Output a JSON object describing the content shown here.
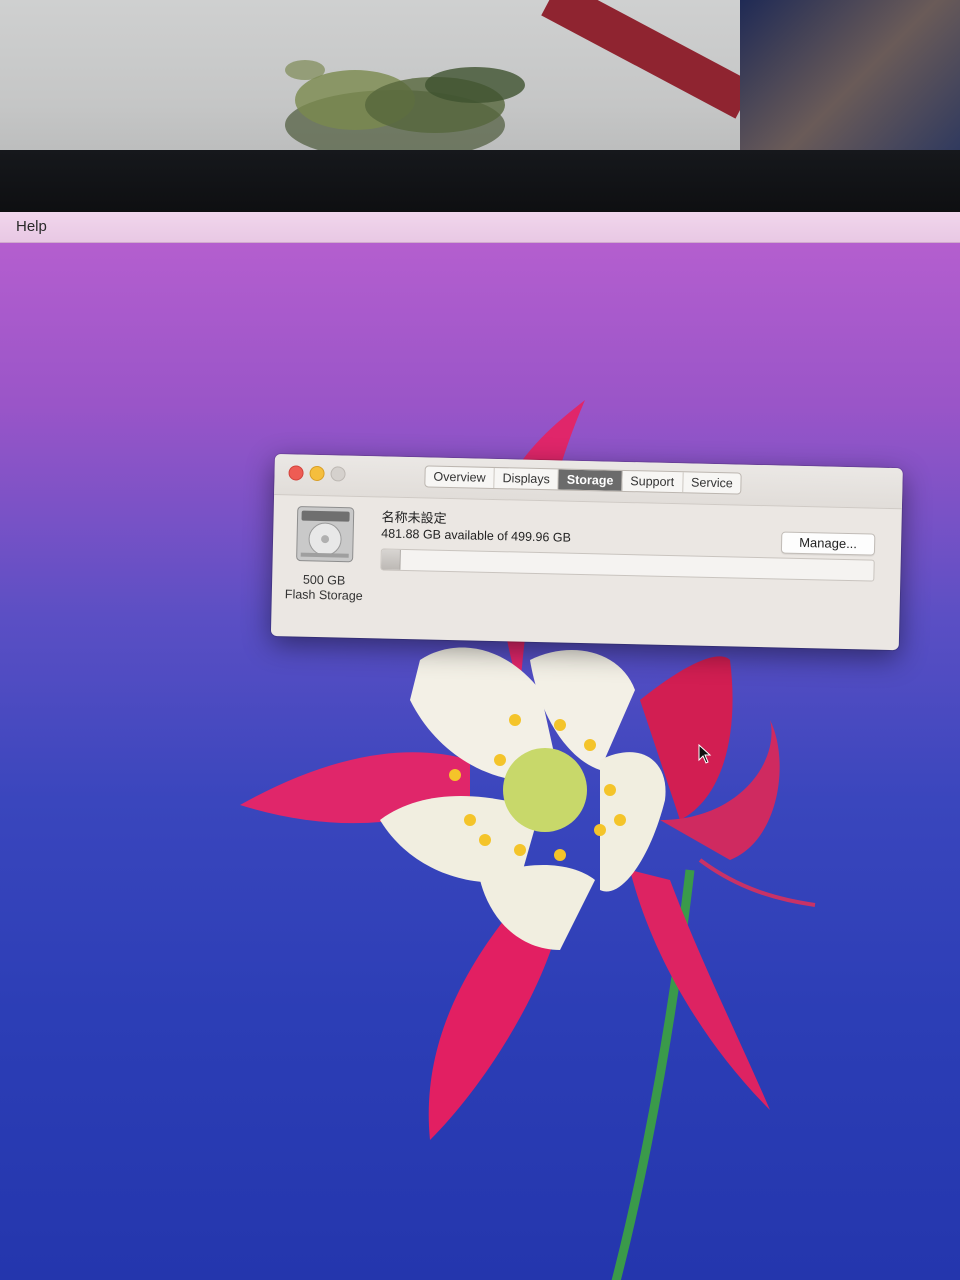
{
  "menubar": {
    "help_label": "Help"
  },
  "window": {
    "tabs": [
      {
        "label": "Overview",
        "active": false
      },
      {
        "label": "Displays",
        "active": false
      },
      {
        "label": "Storage",
        "active": true
      },
      {
        "label": "Support",
        "active": false
      },
      {
        "label": "Service",
        "active": false
      }
    ],
    "disk": {
      "icon": "hard-drive-icon",
      "capacity_label": "500 GB",
      "type_label": "Flash Storage"
    },
    "volume": {
      "name": "名称未設定",
      "availability": "481.88 GB available of 499.96 GB",
      "used_fraction": 0.036
    },
    "manage_label": "Manage..."
  },
  "colors": {
    "close": "#ee5c54",
    "minimize": "#f5be3d",
    "zoom_inactive": "#d5d1cd",
    "active_tab": "#6b6b6b"
  }
}
